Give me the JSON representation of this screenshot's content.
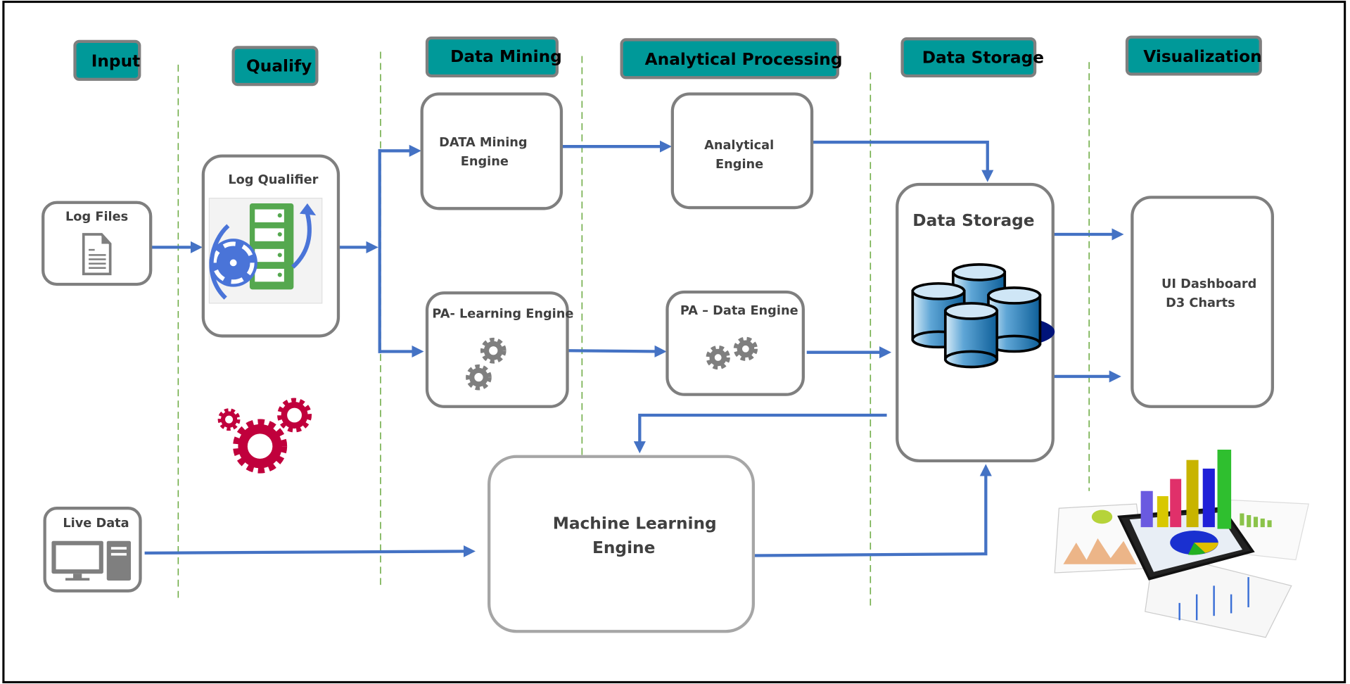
{
  "headers": {
    "input": "Input",
    "qualify": "Qualify",
    "data_mining": "Data Mining",
    "analytical_processing": "Analytical Processing",
    "data_storage": "Data Storage",
    "visualization": "Visualization"
  },
  "nodes": {
    "log_files": "Log Files",
    "log_qualifier": "Log Qualifier",
    "data_mining_engine": [
      "DATA  Mining",
      "Engine"
    ],
    "analytical_engine": [
      "Analytical",
      "Engine"
    ],
    "pa_learning_engine": "PA- Learning Engine",
    "pa_data_engine": "PA – Data Engine",
    "data_storage": "Data Storage",
    "ui_dashboard": [
      "UI Dashboard",
      "D3 Charts"
    ],
    "machine_learning_engine": [
      "Machine Learning",
      "Engine"
    ],
    "live_data": "Live Data"
  },
  "colors": {
    "header_fill": "#009999",
    "arrow": "#4472c4",
    "divider": "#70ad47",
    "box_border": "#7f7f7f",
    "gear_red": "#c0003c",
    "gear_gray": "#7f7f7f"
  },
  "icons": [
    "document-icon",
    "server-fan-icon",
    "gears-icon",
    "database-icon",
    "computer-icon",
    "dashboard-charts-icon"
  ]
}
